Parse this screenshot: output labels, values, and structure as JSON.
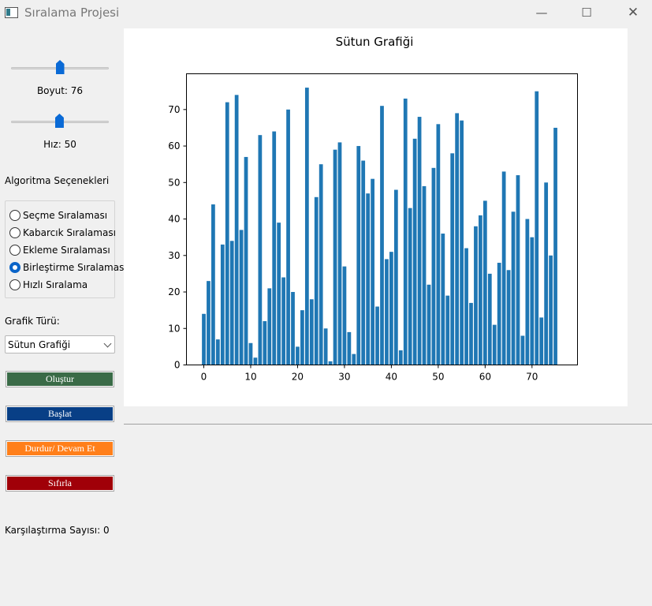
{
  "window": {
    "title": "Sıralama Projesi",
    "minimize_glyph": "—",
    "maximize_glyph": "☐",
    "close_glyph": "✕",
    "icon": "app-window-icon"
  },
  "controls": {
    "size_slider": {
      "value": 76,
      "min": 2,
      "max": 150
    },
    "size_label": "Boyut: 76",
    "speed_slider": {
      "value": 50,
      "min": 1,
      "max": 100
    },
    "speed_label": "Hız: 50",
    "algorithm_heading": "Algoritma Seçenekleri",
    "algorithms": [
      {
        "label": "Seçme Sıralaması",
        "selected": false
      },
      {
        "label": "Kabarcık Sıralaması",
        "selected": false
      },
      {
        "label": "Ekleme Sıralaması",
        "selected": false
      },
      {
        "label": "Birleştirme Sıralaması",
        "selected": true
      },
      {
        "label": "Hızlı Sıralama",
        "selected": false
      }
    ],
    "chart_type_label": "Grafik Türü:",
    "chart_type_value": "Sütun Grafiği",
    "buttons": {
      "create": "Oluştur",
      "start": "Başlat",
      "pause": "Durdur/ Devam Et",
      "reset": "Sıfırla"
    },
    "button_colors": {
      "create": "#3a6b47",
      "start": "#083f86",
      "pause": "#ff7f1a",
      "reset": "#a00008"
    },
    "comparison_label": "Karşılaştırma Sayısı: 0"
  },
  "chart_data": {
    "type": "bar",
    "title": "Sütun Grafiği",
    "xlabel": "",
    "ylabel": "",
    "x": [
      0,
      1,
      2,
      3,
      4,
      5,
      6,
      7,
      8,
      9,
      10,
      11,
      12,
      13,
      14,
      15,
      16,
      17,
      18,
      19,
      20,
      21,
      22,
      23,
      24,
      25,
      26,
      27,
      28,
      29,
      30,
      31,
      32,
      33,
      34,
      35,
      36,
      37,
      38,
      39,
      40,
      41,
      42,
      43,
      44,
      45,
      46,
      47,
      48,
      49,
      50,
      51,
      52,
      53,
      54,
      55,
      56,
      57,
      58,
      59,
      60,
      61,
      62,
      63,
      64,
      65,
      66,
      67,
      68,
      69,
      70,
      71,
      72,
      73,
      74,
      75
    ],
    "values": [
      14,
      23,
      44,
      7,
      33,
      72,
      34,
      74,
      37,
      57,
      6,
      2,
      63,
      12,
      21,
      64,
      39,
      24,
      70,
      20,
      5,
      15,
      76,
      18,
      46,
      55,
      10,
      1,
      59,
      61,
      27,
      9,
      3,
      60,
      56,
      47,
      51,
      16,
      71,
      29,
      31,
      48,
      4,
      73,
      43,
      62,
      68,
      49,
      22,
      54,
      66,
      36,
      19,
      58,
      69,
      67,
      32,
      17,
      38,
      41,
      45,
      25,
      11,
      28,
      53,
      26,
      42,
      52,
      8,
      40,
      35,
      75,
      13,
      50,
      30,
      65
    ],
    "xticks": [
      "0",
      "10",
      "20",
      "30",
      "40",
      "50",
      "60",
      "70"
    ],
    "yticks": [
      "0",
      "10",
      "20",
      "30",
      "40",
      "50",
      "60",
      "70"
    ],
    "xlim": [
      -3.7,
      79.7
    ],
    "ylim": [
      0,
      79.8
    ],
    "bar_color": "#1f77b4",
    "grid": false
  }
}
